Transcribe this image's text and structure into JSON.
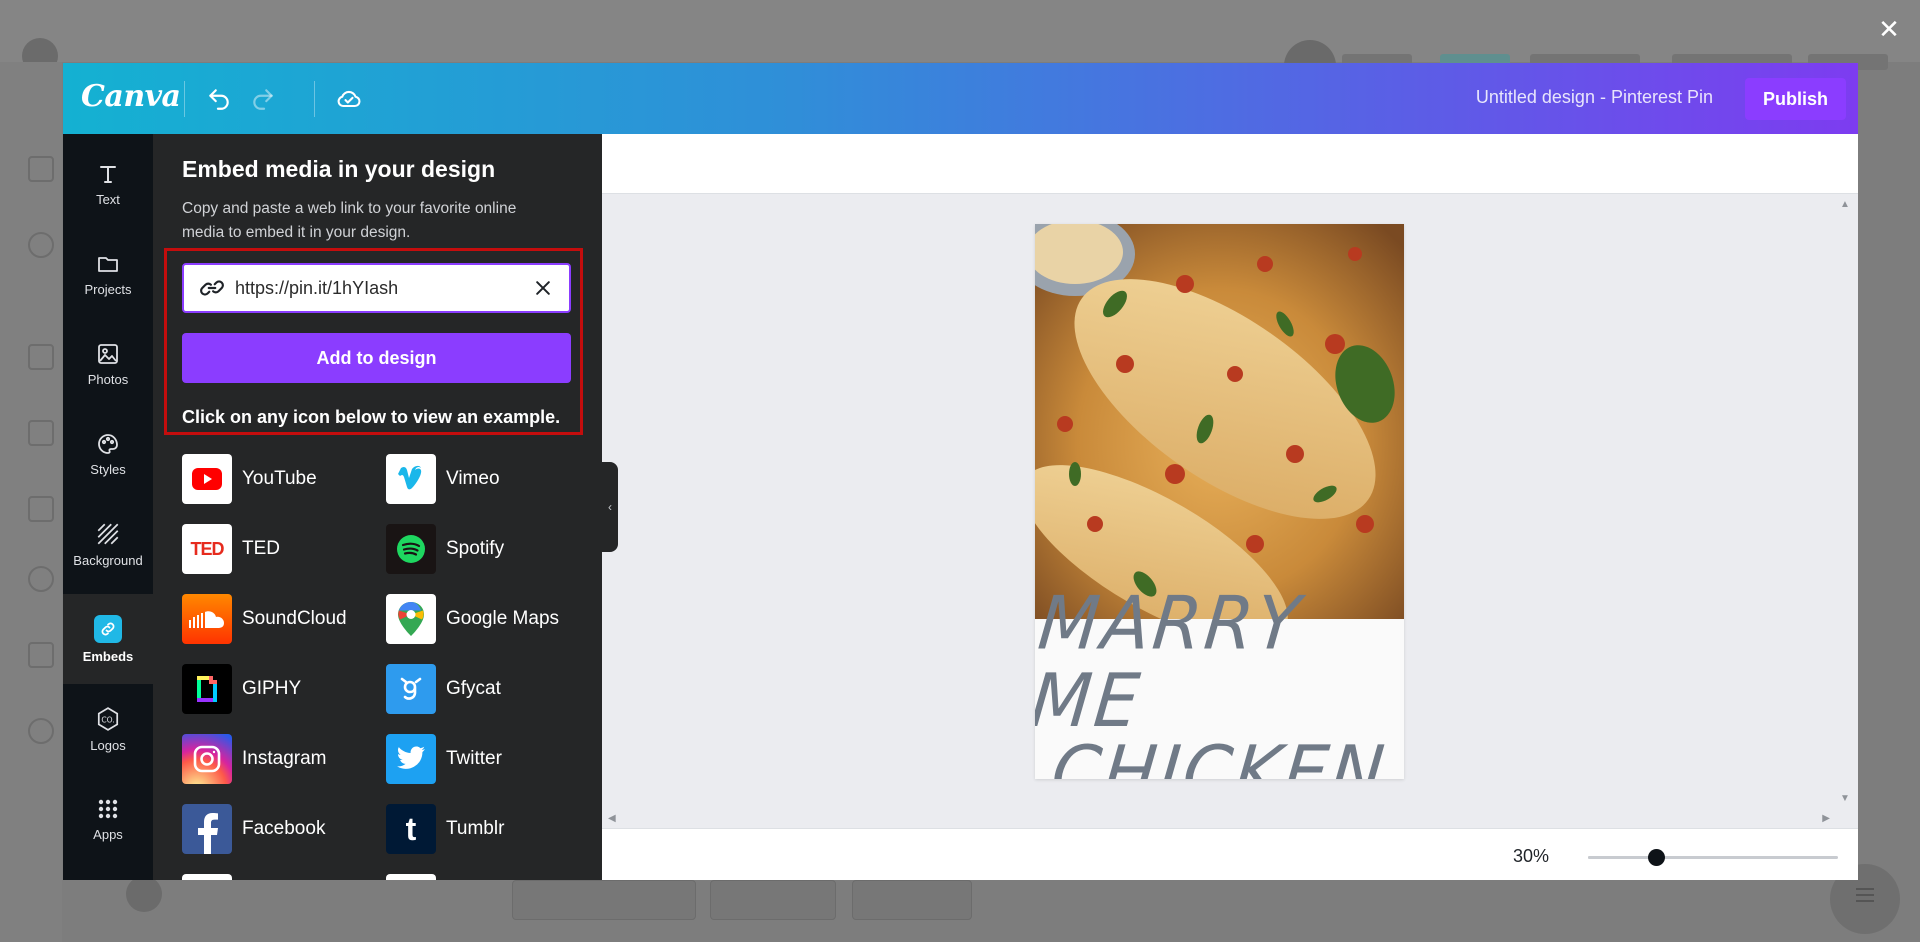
{
  "app": {
    "brand": "Canva",
    "design_title": "Untitled design - Pinterest Pin",
    "publish_label": "Publish",
    "close_icon": "close-icon"
  },
  "sidebar": {
    "items": [
      {
        "label": "Text",
        "icon": "text-icon"
      },
      {
        "label": "Projects",
        "icon": "folder-icon"
      },
      {
        "label": "Photos",
        "icon": "image-icon"
      },
      {
        "label": "Styles",
        "icon": "palette-icon"
      },
      {
        "label": "Background",
        "icon": "background-icon"
      },
      {
        "label": "Embeds",
        "icon": "embed-icon"
      },
      {
        "label": "Logos",
        "icon": "logo-icon"
      },
      {
        "label": "Apps",
        "icon": "apps-icon"
      }
    ],
    "active": "Embeds"
  },
  "panel": {
    "title": "Embed media in your design",
    "description": "Copy and paste a web link to your favorite online media to embed it in your design.",
    "url_value": "https://pin.it/1hYIash",
    "add_button": "Add to design",
    "hint": "Click on any icon below to view an example.",
    "services": [
      {
        "name": "YouTube",
        "color": "#ffffff"
      },
      {
        "name": "Vimeo",
        "color": "#ffffff"
      },
      {
        "name": "TED",
        "color": "#ffffff"
      },
      {
        "name": "Spotify",
        "color": "#191414"
      },
      {
        "name": "SoundCloud",
        "color": "#ff5500"
      },
      {
        "name": "Google Maps",
        "color": "#ffffff"
      },
      {
        "name": "GIPHY",
        "color": "#000000"
      },
      {
        "name": "Gfycat",
        "color": "#2e9bee"
      },
      {
        "name": "Instagram",
        "color": "#d6249f"
      },
      {
        "name": "Twitter",
        "color": "#1da1f2"
      },
      {
        "name": "Facebook",
        "color": "#3b5998"
      },
      {
        "name": "Tumblr",
        "color": "#001935"
      }
    ]
  },
  "design": {
    "text_lines": [
      "MARRY ME",
      "CHICKEN"
    ]
  },
  "zoom": {
    "label": "30%",
    "value": 0.27
  }
}
